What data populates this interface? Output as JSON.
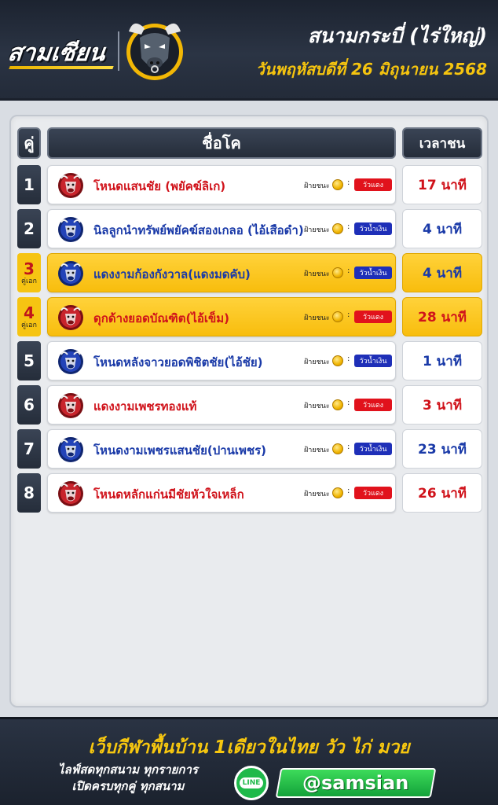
{
  "header": {
    "brand": "สามเซียน",
    "venue": "สนามกระบี่ (ไร่ใหญ่)",
    "date": "วันพฤหัสบดีที่ 26 มิถุนายน 2568"
  },
  "table": {
    "col_no": "คู่",
    "col_name": "ชื่อโค",
    "col_time": "เวลาชน",
    "fav_label": "ฝ้ายชนะ",
    "rows": [
      {
        "no": "1",
        "sub": "",
        "name": "โหนดแสนชัย (พยัคฆ์ลิเก)",
        "side": "วัวแดง",
        "side_color": "red",
        "time": "17 นาที",
        "feature": false
      },
      {
        "no": "2",
        "sub": "",
        "name": "นิลลูกนำทรัพย์พยัคฆ์สองเกลอ (ไอ้เสือดำ)",
        "side": "วัวน้ำเงิน",
        "side_color": "blue",
        "time": "4 นาที",
        "feature": false
      },
      {
        "no": "3",
        "sub": "คู่เอก",
        "name": "แดงงามก้องกังวาล(แดงมดคับ)",
        "side": "วัวน้ำเงิน",
        "side_color": "blue",
        "time": "4 นาที",
        "feature": true
      },
      {
        "no": "4",
        "sub": "คู่เอก",
        "name": "ดุกด้างยอดบัณฑิต(ไอ้เข็ม)",
        "side": "วัวแดง",
        "side_color": "red",
        "time": "28 นาที",
        "feature": true
      },
      {
        "no": "5",
        "sub": "",
        "name": "โหนดหลังจาวยอดพิชิตชัย(ไอ้ชัย)",
        "side": "วัวน้ำเงิน",
        "side_color": "blue",
        "time": "1 นาที",
        "feature": false
      },
      {
        "no": "6",
        "sub": "",
        "name": "แดงงามเพชรทองแท้",
        "side": "วัวแดง",
        "side_color": "red",
        "time": "3 นาที",
        "feature": false
      },
      {
        "no": "7",
        "sub": "",
        "name": "โหนดงามเพชรแสนชัย(ปานเพชร)",
        "side": "วัวน้ำเงิน",
        "side_color": "blue",
        "time": "23 นาที",
        "feature": false
      },
      {
        "no": "8",
        "sub": "",
        "name": "โหนดหลักแก่นมีชัยหัวใจเหล็ก",
        "side": "วัวแดง",
        "side_color": "red",
        "time": "26 นาที",
        "feature": false
      }
    ]
  },
  "footer": {
    "tagline": "เว็บกีฬาพื้นบ้าน 1เดียวในไทย วัว ไก่ มวย",
    "live_line1": "ไลฟ์สดทุกสนาม ทุกรายการ",
    "live_line2": "เปิดครบทุกคู่ ทุกสนาม",
    "line_icon_text": "LINE",
    "handle": "@samsian"
  },
  "colors": {
    "red": "#d0131b",
    "blue": "#1a3aa8",
    "gold": "#f7c70f",
    "green": "#1fb94a"
  }
}
